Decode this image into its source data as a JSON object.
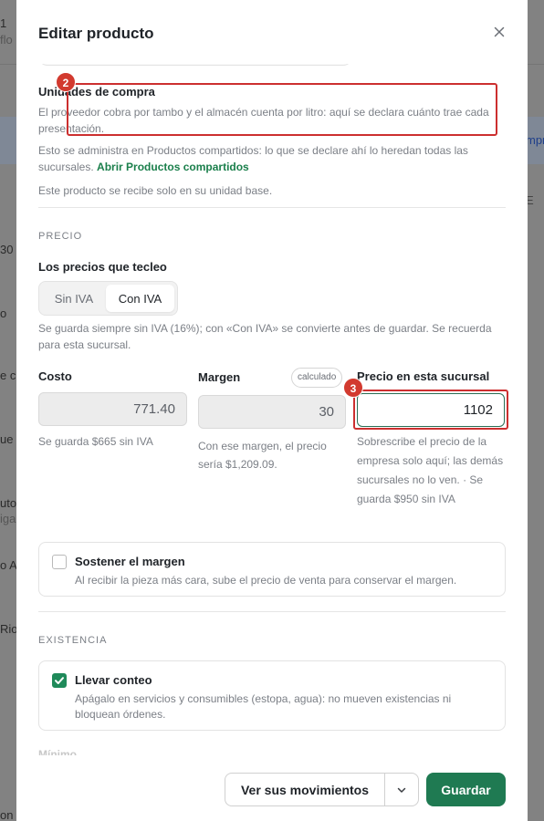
{
  "backdrop": {
    "left_fragments": [
      "1",
      "flo",
      "30",
      "o",
      "e c",
      "ue",
      "uto",
      "iga",
      "o A",
      "Rio",
      "on"
    ],
    "right_fragments": [
      "mpre",
      "E"
    ]
  },
  "modal": {
    "title": "Editar producto",
    "close_icon": "close-icon"
  },
  "purchase_units": {
    "title": "Unidades de compra",
    "description": "El proveedor cobra por tambo y el almacén cuenta por litro: aquí se declara cuánto trae cada presentación.",
    "shared_note": "Esto se administra en Productos compartidos: lo que se declare ahí lo heredan todas las sucursales.",
    "shared_link": "Abrir Productos compartidos",
    "base_unit_note": "Este producto se recibe solo en su unidad base."
  },
  "price": {
    "section_label": "PRECIO",
    "entry_mode_label": "Los precios que tecleo",
    "toggle_options": [
      "Sin IVA",
      "Con IVA"
    ],
    "toggle_selected": "Con IVA",
    "iva_note": "Se guarda siempre sin IVA (16%); con «Con IVA» se convierte antes de guardar. Se recuerda para esta sucursal.",
    "cost_label": "Costo",
    "cost_value": "771.40",
    "cost_note": "Se guarda $665 sin IVA",
    "margin_label": "Margen",
    "margin_badge": "calculado",
    "margin_value": "30",
    "margin_note": "Con ese margen, el precio sería $1,209.09.",
    "branch_price_label": "Precio en esta sucursal",
    "branch_price_value": "1102",
    "branch_price_note": "Sobrescribe el precio de la empresa solo aquí; las demás sucursales no lo ven. · Se guarda $950 sin IVA"
  },
  "hold_margin": {
    "checked": false,
    "title": "Sostener el margen",
    "description": "Al recibir la pieza más cara, sube el precio de venta para conservar el margen."
  },
  "stock": {
    "section_label": "EXISTENCIA",
    "track_checked": true,
    "track_title": "Llevar conteo",
    "track_description": "Apágalo en servicios y consumibles (estopa, agua): no mueven existencias ni bloquean órdenes.",
    "minimum_label": "Mínimo"
  },
  "annotations": [
    "2",
    "3"
  ],
  "footer": {
    "movements_button": "Ver sus movimientos",
    "save_button": "Guardar"
  },
  "colors": {
    "primary": "#1f7a52",
    "link": "#1a7f4b",
    "annotation": "#cc2f2f",
    "checkbox_checked": "#1f8a5a"
  }
}
